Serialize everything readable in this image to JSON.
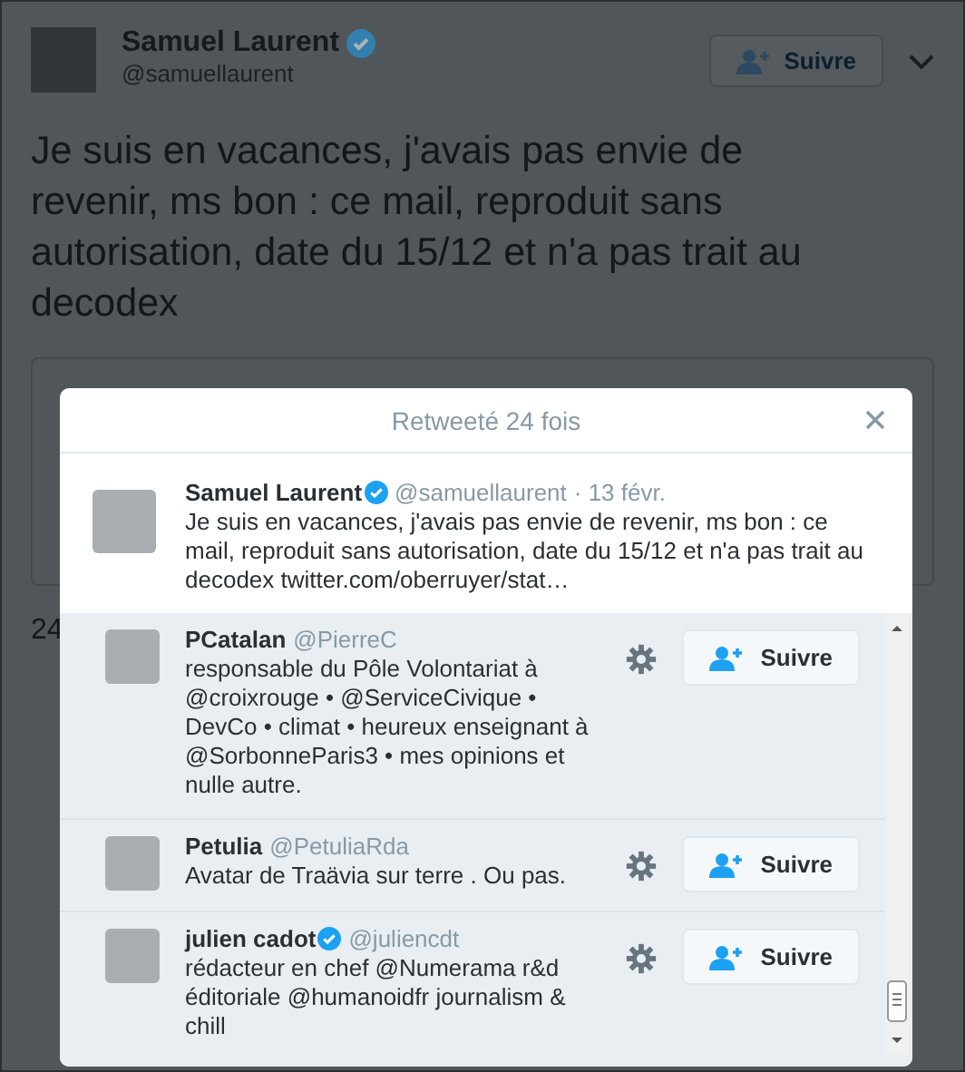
{
  "background_tweet": {
    "author": {
      "name": "Samuel Laurent",
      "handle": "@samuellaurent",
      "verified": true
    },
    "follow_button": "Suivre",
    "text": "Je suis en vacances, j'avais pas envie de revenir, ms bon : ce mail, reproduit sans autorisation, date du 15/12 et n'a pas trait au decodex",
    "retweet_count": "24"
  },
  "dialog": {
    "title": "Retweeté 24 fois",
    "original_tweet": {
      "name": "Samuel Laurent",
      "verified": true,
      "handle": "@samuellaurent",
      "date": "· 13 févr.",
      "text": "Je suis en vacances, j'avais pas envie de revenir, ms bon : ce mail, reproduit sans autorisation, date du 15/12 et n'a pas trait au decodex",
      "link": "twitter.com/oberruyer/stat…"
    },
    "retweeters": [
      {
        "name": "PCatalan",
        "verified": false,
        "handle": "@PierreC",
        "bio": "responsable du Pôle Volontariat à @croixrouge • @ServiceCivique • DevCo • climat • heureux enseignant à @SorbonneParis3 • mes opinions et nulle autre.",
        "follow_label": "Suivre"
      },
      {
        "name": "Petulia",
        "verified": false,
        "handle": "@PetuliaRda",
        "bio": "Avatar de Traävia sur terre . Ou pas.",
        "follow_label": "Suivre"
      },
      {
        "name": "julien cadot",
        "verified": true,
        "handle": "@juliencdt",
        "bio": "rédacteur en chef @Numerama r&d éditoriale @humanoidfr journalism & chill",
        "follow_label": "Suivre"
      }
    ]
  }
}
